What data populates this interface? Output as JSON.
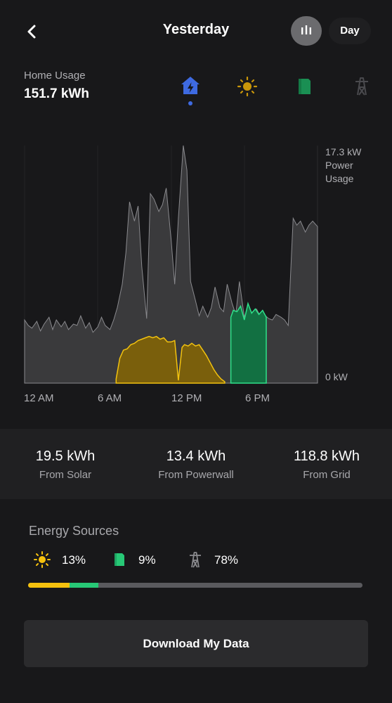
{
  "header": {
    "title": "Yesterday",
    "period_label": "Day",
    "back_icon": "chevron-left-icon",
    "chart_toggle_icon": "bar-chart-icon"
  },
  "usage": {
    "label": "Home Usage",
    "value": "151.7 kWh"
  },
  "source_icons": [
    "home-bolt-icon",
    "sun-icon",
    "powerwall-icon",
    "grid-tower-icon"
  ],
  "colors": {
    "background": "#18181a",
    "accent_blue": "#3e6ae1",
    "solar": "#f5c10e",
    "powerwall": "#27c876",
    "grid": "#5a5a5e",
    "usage_fill": "#3a3a3c"
  },
  "chart_data": {
    "type": "area",
    "x_ticks": [
      "12 AM",
      "6 AM",
      "12 PM",
      "6 PM"
    ],
    "y_max_label": "17.3 kW",
    "y_min_label": "0 kW",
    "y_unit_label_1": "Power",
    "y_unit_label_2": "Usage",
    "ylim": [
      0,
      17.3
    ],
    "xlim": [
      0,
      24
    ],
    "series": [
      {
        "key": "usage",
        "x": [
          0,
          0.3,
          0.6,
          1.0,
          1.3,
          1.6,
          2.0,
          2.3,
          2.6,
          3.0,
          3.3,
          3.6,
          4.0,
          4.3,
          4.6,
          5.0,
          5.3,
          5.6,
          6.0,
          6.3,
          6.6,
          7.0,
          7.3,
          7.6,
          8.0,
          8.3,
          8.6,
          9.0,
          9.3,
          9.6,
          10.0,
          10.3,
          10.6,
          11.0,
          11.3,
          11.6,
          12.0,
          12.3,
          12.6,
          13.0,
          13.3,
          13.6,
          14.0,
          14.3,
          14.6,
          15.0,
          15.3,
          15.6,
          16.0,
          16.3,
          16.6,
          17.0,
          17.3,
          17.6,
          18.0,
          18.3,
          18.6,
          19.0,
          19.3,
          19.6,
          20.0,
          20.3,
          20.6,
          21.0,
          21.3,
          21.6,
          22.0,
          22.3,
          22.6,
          23.0,
          23.3,
          23.6,
          24.0
        ],
        "y": [
          4.6,
          4.2,
          4.0,
          4.5,
          3.8,
          4.3,
          4.8,
          3.9,
          4.6,
          4.1,
          4.5,
          3.9,
          4.3,
          4.2,
          4.9,
          4.0,
          4.4,
          3.7,
          4.1,
          4.8,
          4.2,
          3.9,
          4.6,
          5.5,
          7.2,
          9.5,
          13.2,
          11.8,
          12.9,
          8.5,
          4.7,
          13.8,
          13.4,
          12.5,
          13.0,
          14.2,
          10.5,
          7.2,
          12.0,
          17.3,
          15.5,
          7.4,
          6.0,
          4.9,
          5.6,
          4.8,
          5.5,
          7.0,
          5.5,
          5.2,
          7.2,
          5.8,
          5.0,
          7.4,
          4.8,
          5.5,
          5.1,
          5.4,
          4.9,
          5.0,
          4.7,
          4.6,
          5.0,
          4.8,
          4.6,
          4.2,
          12.0,
          11.5,
          11.8,
          11.0,
          11.5,
          11.8,
          11.4
        ]
      },
      {
        "key": "solar",
        "x": [
          7.5,
          7.8,
          8.1,
          8.4,
          8.7,
          9.0,
          9.3,
          9.6,
          9.9,
          10.2,
          10.5,
          10.8,
          11.1,
          11.4,
          11.7,
          12.0,
          12.3,
          12.6,
          12.9,
          13.1,
          13.4,
          13.7,
          14.0,
          14.3,
          14.6,
          14.9,
          15.2,
          15.5,
          15.8,
          16.1,
          16.4
        ],
        "y": [
          0.3,
          1.8,
          2.4,
          2.5,
          2.8,
          2.9,
          3.1,
          3.2,
          3.3,
          3.4,
          3.3,
          3.4,
          3.2,
          3.3,
          3.0,
          3.0,
          3.1,
          0.2,
          2.6,
          2.8,
          2.7,
          2.9,
          2.7,
          2.8,
          2.4,
          2.0,
          1.5,
          1.0,
          0.6,
          0.3,
          0.1
        ]
      },
      {
        "key": "powerwall",
        "x": [
          16.9,
          17.1,
          17.4,
          17.7,
          18.0,
          18.3,
          18.6,
          18.9,
          19.2,
          19.5,
          19.8
        ],
        "y": [
          4.8,
          5.3,
          5.2,
          5.6,
          4.6,
          5.8,
          5.1,
          5.4,
          5.0,
          5.3,
          4.8
        ]
      }
    ]
  },
  "totals": [
    {
      "value": "19.5 kWh",
      "label": "From Solar"
    },
    {
      "value": "13.4 kWh",
      "label": "From Powerwall"
    },
    {
      "value": "118.8 kWh",
      "label": "From Grid"
    }
  ],
  "energy_sources": {
    "title": "Energy Sources",
    "solar_pct": "13%",
    "powerwall_pct": "9%",
    "grid_pct": "78%",
    "solar_share": 0.13,
    "powerwall_share": 0.09,
    "grid_share": 0.78
  },
  "download_label": "Download My Data"
}
